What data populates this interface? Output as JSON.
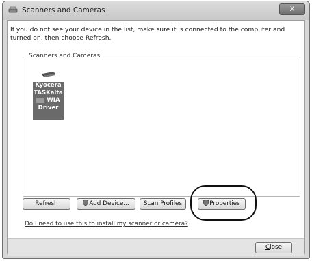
{
  "window": {
    "title": "Scanners and Cameras",
    "close_glyph": "X"
  },
  "instructions": "If you do not see your device in the list, make sure it is connected to the computer and turned on, then choose Refresh.",
  "device_list": {
    "group_label": "Scanners and Cameras",
    "devices": [
      {
        "line1": "Kyocera",
        "line2": "TASKalfa",
        "line3": "WIA",
        "line4": "Driver",
        "icon": "scanner-icon"
      }
    ]
  },
  "buttons": {
    "refresh": {
      "mnemonic": "R",
      "rest": "efresh"
    },
    "add_device": {
      "mnemonic": "A",
      "rest": "dd Device...",
      "icon": "shield-icon"
    },
    "scan_profiles": {
      "mnemonic": "S",
      "rest": "can Profiles"
    },
    "properties": {
      "mnemonic": "P",
      "rest": "roperties",
      "icon": "shield-icon"
    },
    "close": {
      "mnemonic": "C",
      "rest": "lose"
    }
  },
  "help_link": "Do I need to use this to install my scanner or camera?",
  "colors": {
    "title_bar": "#c8c8c8",
    "close_button": "#7a7a7a",
    "device_selected": "#6a6a6a"
  }
}
